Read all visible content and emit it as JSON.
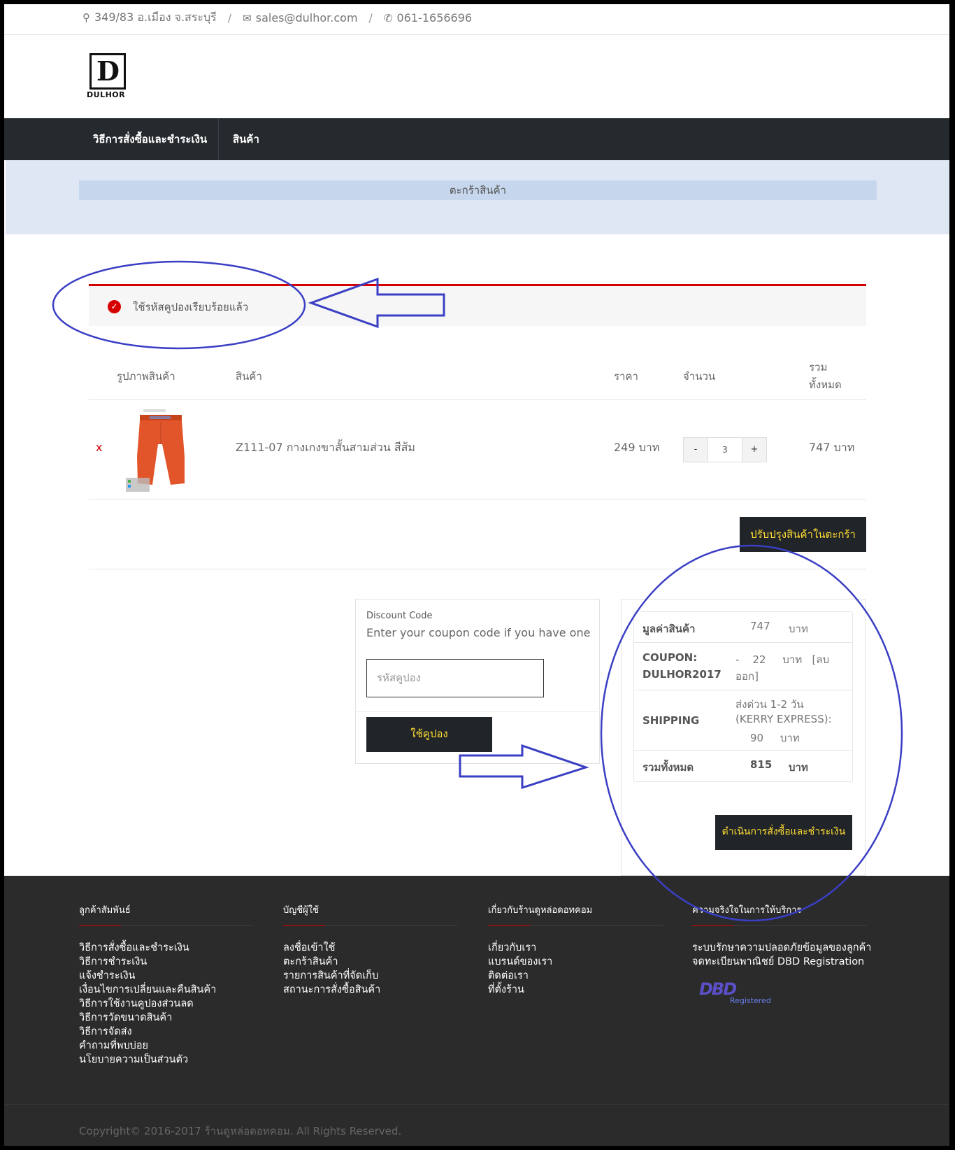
{
  "topbar": {
    "address": "349/83 อ.เมือง จ.สระบุรี",
    "email": "sales@dulhor.com",
    "phone": "061-1656696",
    "separator": "/"
  },
  "logo": {
    "mark": "D",
    "text": "DULHOR"
  },
  "nav": {
    "items": [
      "วิธีการสั่งซื้อและชำระเงิน",
      "สินค้า"
    ]
  },
  "breadcrumb": "ตะกร้าสินค้า",
  "alert": {
    "message": "ใช้รหัสคูปองเรียบร้อยแล้ว"
  },
  "cart": {
    "headers": {
      "image": "รูปภาพสินค้า",
      "product": "สินค้า",
      "price": "ราคา",
      "qty": "จำนวน",
      "total_line1": "รวม",
      "total_line2": "ทั้งหมด"
    },
    "items": [
      {
        "remove": "x",
        "name": "Z111-07 กางเกงขาสั้นสามส่วน สีส้ม",
        "price": "249 บาท",
        "qty": "3",
        "total": "747 บาท",
        "minus": "-",
        "plus": "+"
      }
    ],
    "update_button": "ปรับปรุงสินค้าในตะกร้า"
  },
  "coupon": {
    "label": "Discount Code",
    "hint": "Enter your coupon code if you have one",
    "placeholder": "รหัสคูปอง",
    "button": "ใช้คูปอง"
  },
  "totals": {
    "subtotal_label": "มูลค่าสินค้า",
    "subtotal_value": "747",
    "subtotal_unit": "บาท",
    "coupon_label_1": "COUPON:",
    "coupon_label_2": "DULHOR2017",
    "coupon_value_line1": "-    22     บาท   [ลบ",
    "coupon_value_line2": "ออก]",
    "shipping_label": "SHIPPING",
    "shipping_line1": "ส่งด่วน 1-2 วัน",
    "shipping_line2": "(KERRY EXPRESS):",
    "shipping_line3": "90     บาท",
    "total_label": "รวมทั้งหมด",
    "total_value": "815",
    "total_unit": "บาท",
    "checkout_button": "ดำเนินการสั่งซื้อและชำระเงิน"
  },
  "footer": {
    "columns": [
      {
        "title": "ลูกค้าสัมพันธ์",
        "links": [
          "วิธีการสั่งซื้อและชำระเงิน",
          "วิธีการชำระเงิน",
          "แจ้งชำระเงิน",
          "เงื่อนไขการเปลี่ยนและคืนสินค้า",
          "วิธีการใช้งานคูปองส่วนลด",
          "วิธีการวัดขนาดสินค้า",
          "วิธีการจัดส่ง",
          "คำถามที่พบบ่อย",
          "นโยบายความเป็นส่วนตัว"
        ]
      },
      {
        "title": "บัญชีผู้ใช้",
        "links": [
          "ลงชื่อเข้าใช้",
          "ตะกร้าสินค้า",
          "รายการสินค้าที่จัดเก็บ",
          "สถานะการสั่งซื้อสินค้า"
        ]
      },
      {
        "title": "เกี่ยวกับร้านดูหล่อดอทคอม",
        "links": [
          "เกี่ยวกับเรา",
          "แบรนด์ของเรา",
          "ติดต่อเรา",
          "ที่ตั้งร้าน"
        ]
      },
      {
        "title": "ความจริงใจในการให้บริการ",
        "links": [
          "ระบบรักษาความปลอดภัยข้อมูลของลูกค้า",
          "จดทะเบียนพาณิชย์ DBD Registration"
        ]
      }
    ],
    "dbd_mark": "DBD",
    "dbd_sub": "Registered",
    "copyright": "Copyright© 2016-2017 ร้านดูหล่อดอทคอม. All Rights Reserved."
  },
  "colors": {
    "nav_bg": "#252a2e",
    "accent_red": "#d60000",
    "button_text": "#ffdd33",
    "annotation": "#3a3fc4"
  }
}
